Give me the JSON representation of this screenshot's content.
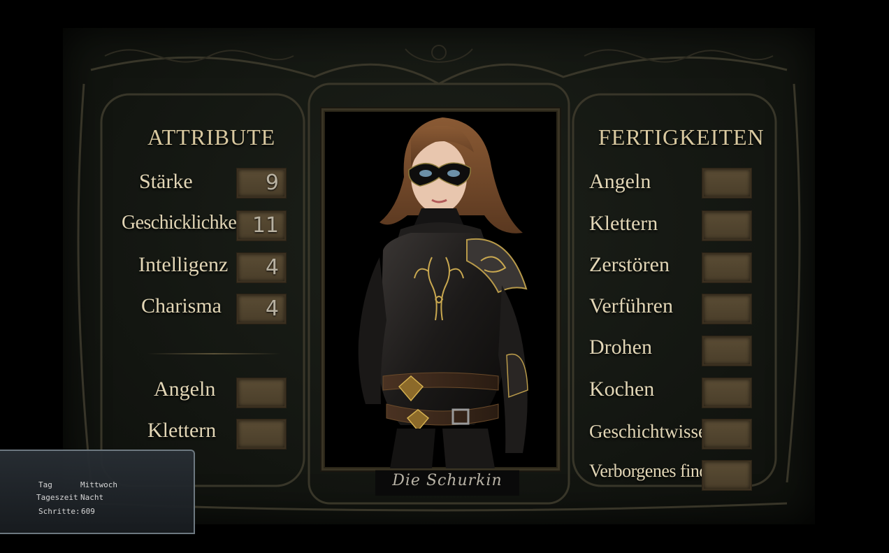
{
  "attributes": {
    "heading": "ATTRIBUTE",
    "items": [
      {
        "label": "Stärke",
        "value": "9"
      },
      {
        "label": "Geschicklichkeit",
        "value": "11"
      },
      {
        "label": "Intelligenz",
        "value": "4"
      },
      {
        "label": "Charisma",
        "value": "4"
      }
    ],
    "extra": [
      {
        "label": "Angeln",
        "value": ""
      },
      {
        "label": "Klettern",
        "value": ""
      }
    ]
  },
  "skills": {
    "heading": "FERTIGKEITEN",
    "items": [
      {
        "label": "Angeln",
        "value": ""
      },
      {
        "label": "Klettern",
        "value": ""
      },
      {
        "label": "Zerstören",
        "value": ""
      },
      {
        "label": "Verführen",
        "value": ""
      },
      {
        "label": "Drohen",
        "value": ""
      },
      {
        "label": "Kochen",
        "value": ""
      },
      {
        "label": "Geschichtwissen",
        "value": ""
      },
      {
        "label": "Verborgenes finden",
        "value": ""
      }
    ]
  },
  "character": {
    "name": "Die Schurkin",
    "portrait_icon": "masked-rogue-portrait"
  },
  "hud": {
    "day_label": "Tag",
    "day_value": "Mittwoch",
    "time_label": "Tageszeit",
    "time_value": "Nacht",
    "steps_label": "Schritte:",
    "steps_value": "609"
  },
  "colors": {
    "panel_bg": "#141712",
    "text_gold": "#e2d6b6",
    "box_fill": "#5a4c34"
  }
}
